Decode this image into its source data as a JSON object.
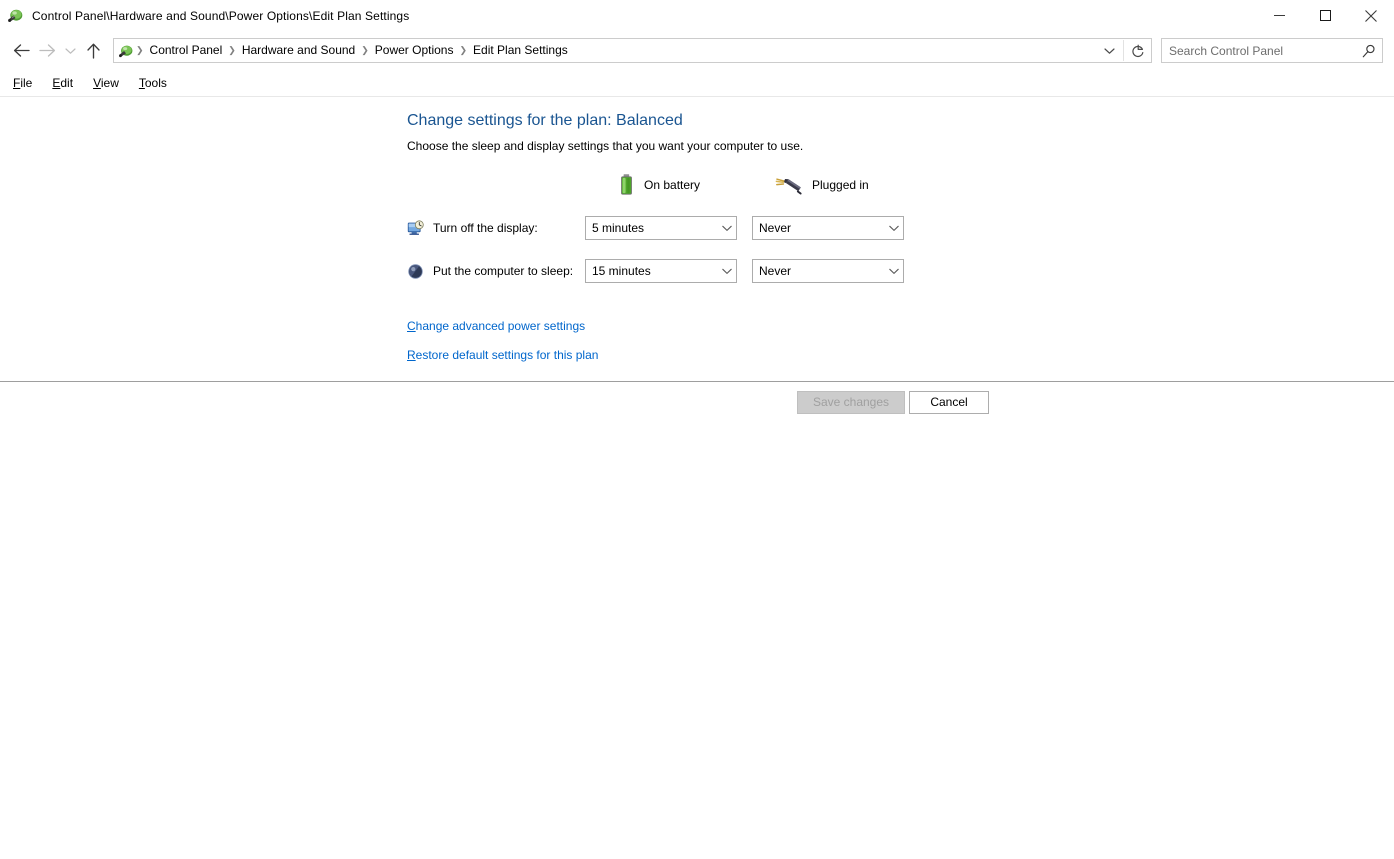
{
  "window": {
    "title": "Control Panel\\Hardware and Sound\\Power Options\\Edit Plan Settings",
    "title_icon": "control-panel-power-icon",
    "controls": {
      "minimize": "minimize-icon",
      "maximize": "maximize-icon",
      "close": "close-icon"
    }
  },
  "nav": {
    "back": "back-arrow-icon",
    "forward": "forward-arrow-icon",
    "history": "chevron-down-icon",
    "up": "up-arrow-icon",
    "refresh": "refresh-icon",
    "address_chevron": "chevron-down-icon",
    "address_icon": "control-panel-power-icon",
    "breadcrumbs": [
      "Control Panel",
      "Hardware and Sound",
      "Power Options",
      "Edit Plan Settings"
    ],
    "separator": "❯"
  },
  "search": {
    "placeholder": "Search Control Panel",
    "value": "",
    "icon": "search-icon"
  },
  "menubar": {
    "items": [
      {
        "accesskey": "F",
        "rest": "ile"
      },
      {
        "accesskey": "E",
        "rest": "dit"
      },
      {
        "accesskey": "V",
        "rest": "iew"
      },
      {
        "accesskey": "T",
        "rest": "ools"
      }
    ]
  },
  "main": {
    "title": "Change settings for the plan: Balanced",
    "subtitle": "Choose the sleep and display settings that you want your computer to use.",
    "columns": [
      {
        "label": "On battery",
        "icon": "battery-icon"
      },
      {
        "label": "Plugged in",
        "icon": "power-plug-icon"
      }
    ],
    "rows": [
      {
        "label": "Turn off the display:",
        "icon": "display-clock-icon",
        "battery_value": "5 minutes",
        "plugged_value": "Never"
      },
      {
        "label": "Put the computer to sleep:",
        "icon": "sleep-moon-icon",
        "battery_value": "15 minutes",
        "plugged_value": "Never"
      }
    ],
    "links": [
      {
        "accesskey": "C",
        "rest": "hange advanced power settings"
      },
      {
        "accesskey": "R",
        "rest": "estore default settings for this plan"
      }
    ]
  },
  "footer": {
    "save_label": "Save changes",
    "save_disabled": true,
    "cancel_label": "Cancel"
  },
  "colors": {
    "title_blue": "#1a5591",
    "link_blue": "#0066cc",
    "battery_green": "#4caf2a",
    "combo_border": "#acacac",
    "accent_edge": "#cfe6ef"
  }
}
